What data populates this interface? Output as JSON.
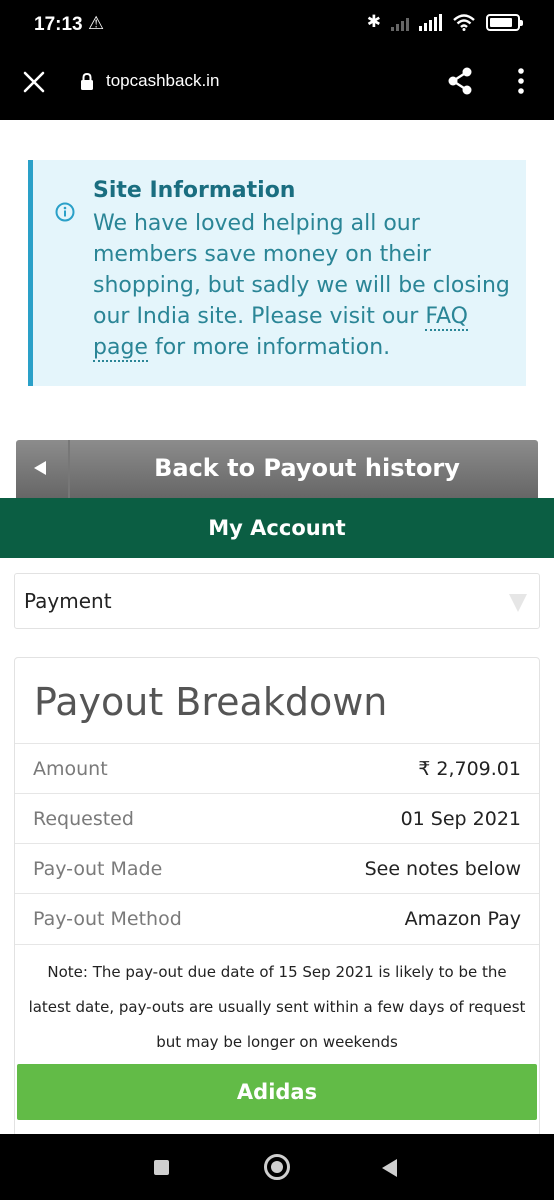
{
  "status_bar": {
    "time": "17:13",
    "warning_icon": "warning-icon",
    "bluetooth_icon": "bluetooth-icon",
    "battery_level": 0.85
  },
  "browser": {
    "url": "topcashback.in"
  },
  "info_banner": {
    "title": "Site Information",
    "body_text": "We have loved helping all our members save money on their shopping, but sadly we will be closing our India site. Please visit our",
    "link_text": "FAQ page",
    "body_suffix": " for more information."
  },
  "back_button": {
    "label": "Back to Payout history"
  },
  "account_bar": {
    "label": "My Account"
  },
  "select": {
    "value": "Payment"
  },
  "breakdown": {
    "title": "Payout Breakdown",
    "rows": [
      {
        "label": "Amount",
        "value": "₹ 2,709.01"
      },
      {
        "label": "Requested",
        "value": "01 Sep 2021"
      },
      {
        "label": "Pay-out Made",
        "value": "See notes below"
      },
      {
        "label": "Pay-out Method",
        "value": "Amazon Pay"
      }
    ],
    "note": "Note: The pay-out due date of 15 Sep 2021 is likely to be the latest date, pay-outs are usually sent within a few days of request but may be longer on weekends",
    "retailer": "Adidas"
  },
  "colors": {
    "account_bar": "#0b5e43",
    "retailer_button": "#62bb47",
    "info_accent": "#2aa0c8"
  }
}
